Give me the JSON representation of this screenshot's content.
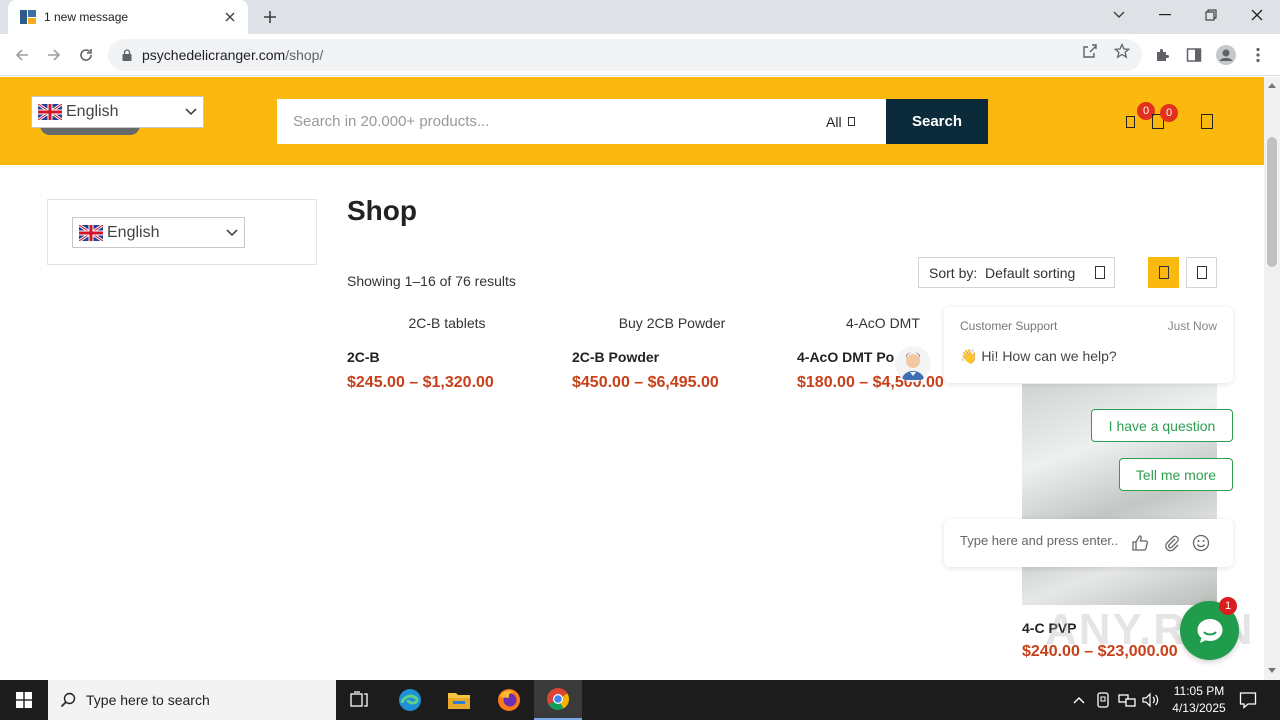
{
  "browser": {
    "tab_title": "1 new message",
    "url_domain": "psychedelicranger.com",
    "url_path": "/shop/"
  },
  "header": {
    "language": "English",
    "search_placeholder": "Search in 20.000+ products...",
    "category": "All",
    "search_button": "Search",
    "wishlist_count": "0",
    "cart_count": "0"
  },
  "sidebar": {
    "language": "English"
  },
  "shop": {
    "title": "Shop",
    "results": "Showing 1–16 of 76 results",
    "sort_label": "Sort by:",
    "sort_value": "Default sorting",
    "products": [
      {
        "img_alt": "2C-B tablets",
        "name": "2C-B",
        "price": "$245.00 – $1,320.00"
      },
      {
        "img_alt": "Buy 2CB Powder",
        "name": "2C-B Powder",
        "price": "$450.00 – $6,495.00"
      },
      {
        "img_alt": "4-AcO DMT",
        "name": "4-AcO DMT Po",
        "price": "$180.00 – $4,500.00"
      },
      {
        "img_alt": "",
        "name": "4-C PVP",
        "price": "$240.00 – $23,000.00"
      }
    ]
  },
  "chat": {
    "agent": "Customer Support",
    "time": "Just Now",
    "greeting": "👋 Hi! How can we help?",
    "choice_1": "I have a question",
    "choice_2": "Tell me more",
    "input_placeholder": "Type here and press enter..",
    "unread": "1"
  },
  "watermark": "ANY.RUN",
  "taskbar": {
    "search_placeholder": "Type here to search",
    "time": "11:05 PM",
    "date": "4/13/2025"
  },
  "colors": {
    "header_bg": "#fbb80f",
    "search_button_bg": "#0b2b3b",
    "price": "#c8401a",
    "chat_green": "#1f9d4c",
    "badge_red": "#e3301c"
  }
}
